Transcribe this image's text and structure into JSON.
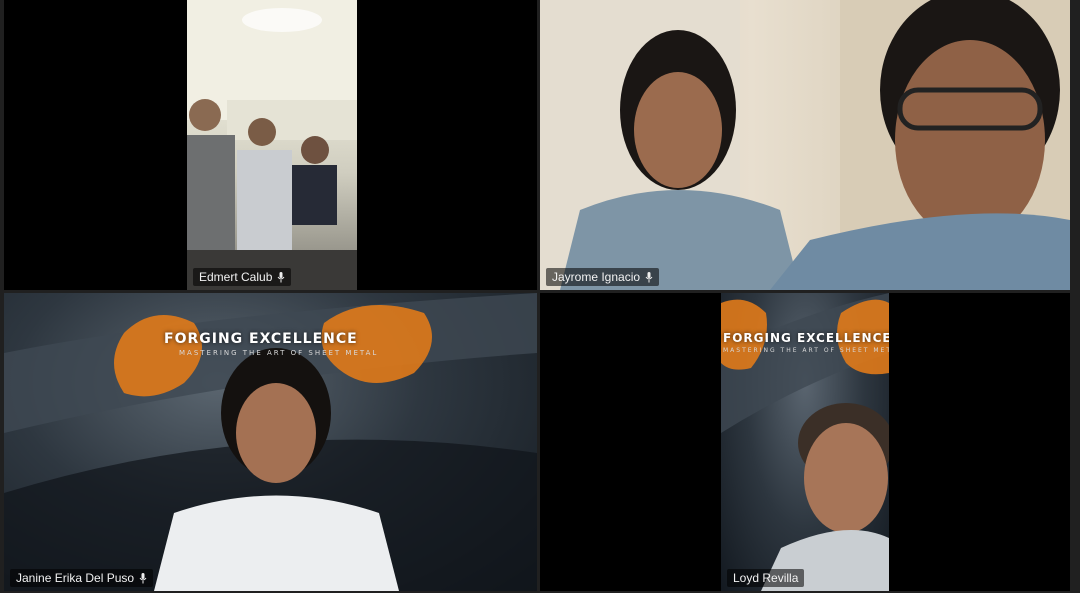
{
  "participants": [
    {
      "name": "Edmert Calub"
    },
    {
      "name": "Jayrome Ignacio"
    },
    {
      "name": "Janine Erika Del Puso"
    },
    {
      "name": "Loyd Revilla"
    }
  ],
  "background": {
    "title": "FORGING EXCELLENCE",
    "subtitle": "MASTERING THE ART OF SHEET METAL"
  },
  "icons": {
    "mic": "microphone-icon"
  }
}
